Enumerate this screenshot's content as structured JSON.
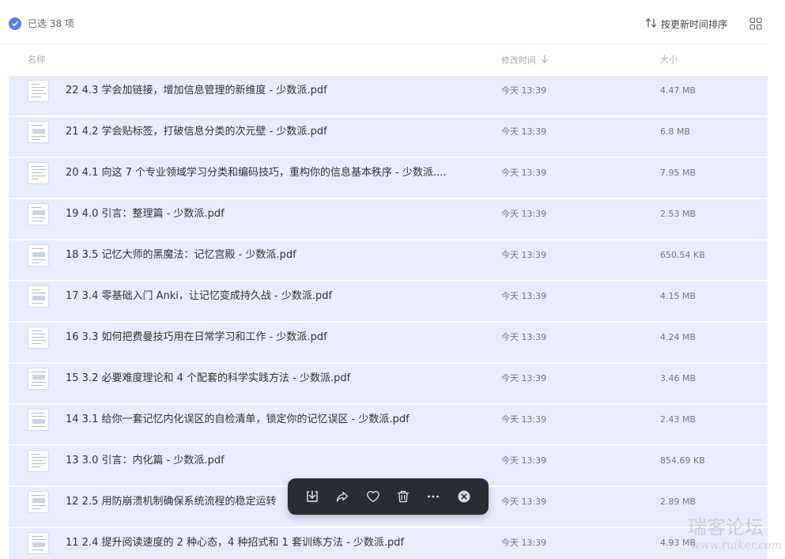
{
  "header": {
    "selected_text": "已选 38 项",
    "sort_label": "按更新时间排序",
    "accent_color": "#5b7bf0"
  },
  "columns": {
    "name": "名称",
    "modified": "修改时间",
    "size": "大小"
  },
  "files": [
    {
      "name": "22 4.3 学会加链接，增加信息管理的新维度 - 少数派.pdf",
      "date": "今天 13:39",
      "size": "4.47 MB"
    },
    {
      "name": "21 4.2 学会贴标签，打破信息分类的次元壁 - 少数派.pdf",
      "date": "今天 13:39",
      "size": "6.8 MB"
    },
    {
      "name": "20 4.1 向这 7 个专业领域学习分类和编码技巧，重构你的信息基本秩序 - 少数派....",
      "date": "今天 13:39",
      "size": "7.95 MB"
    },
    {
      "name": "19 4.0 引言：整理篇 - 少数派.pdf",
      "date": "今天 13:39",
      "size": "2.53 MB"
    },
    {
      "name": "18 3.5 记忆大师的黑魔法：记忆宫殿 - 少数派.pdf",
      "date": "今天 13:39",
      "size": "650.54 KB"
    },
    {
      "name": "17 3.4 零基础入门 Anki，让记忆变成持久战 - 少数派.pdf",
      "date": "今天 13:39",
      "size": "4.15 MB"
    },
    {
      "name": "16 3.3 如何把费曼技巧用在日常学习和工作 - 少数派.pdf",
      "date": "今天 13:39",
      "size": "4.24 MB"
    },
    {
      "name": "15 3.2 必要难度理论和 4 个配套的科学实践方法 - 少数派.pdf",
      "date": "今天 13:39",
      "size": "3.46 MB"
    },
    {
      "name": "14 3.1 给你一套记忆内化误区的自检清单，锁定你的记忆误区 - 少数派.pdf",
      "date": "今天 13:39",
      "size": "2.43 MB"
    },
    {
      "name": "13 3.0 引言：内化篇 - 少数派.pdf",
      "date": "今天 13:39",
      "size": "854.69 KB"
    },
    {
      "name": "12 2.5 用防崩溃机制确保系统流程的稳定运转",
      "date": "今天 13:39",
      "size": "2.89 MB"
    },
    {
      "name": "11 2.4 提升阅读速度的 2 种心态，4 种招式和 1 套训练方法 - 少数派.pdf",
      "date": "今天 13:39",
      "size": "4.93 MB"
    }
  ],
  "action_bar": {
    "items": [
      "download-icon",
      "share-icon",
      "heart-icon",
      "trash-icon",
      "more-icon",
      "close-icon"
    ]
  },
  "watermark": {
    "main": "瑞客论坛",
    "sub": "www.ruiker.com"
  }
}
